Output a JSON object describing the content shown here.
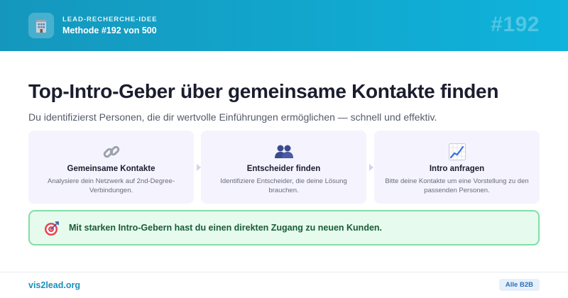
{
  "header": {
    "kicker": "LEAD-RECHERCHE-IDEE",
    "method": "Methode #192 von 500",
    "number": "#192",
    "logo_icon": "building-icon"
  },
  "main": {
    "title": "Top-Intro-Geber über gemeinsame Kontakte finden",
    "subtitle": "Du identifizierst Personen, die dir wertvolle Einführungen ermöglichen — schnell und effektiv."
  },
  "steps": [
    {
      "icon": "link-icon",
      "title": "Gemeinsame Kontakte",
      "description": "Analysiere dein Netzwerk auf 2nd-Degree-Verbindungen."
    },
    {
      "icon": "people-icon",
      "title": "Entscheider finden",
      "description": "Identifiziere Entscheider, die deine Lösung brauchen."
    },
    {
      "icon": "chart-up-icon",
      "title": "Intro anfragen",
      "description": "Bitte deine Kontakte um eine Vorstellung zu den passenden Personen."
    }
  ],
  "callout": {
    "icon": "target-icon",
    "text": "Mit starken Intro-Gebern hast du einen direkten Zugang zu neuen Kunden."
  },
  "footer": {
    "brand": "vis2lead.org",
    "badge": "Alle B2B"
  },
  "colors": {
    "header_start": "#1597bd",
    "header_end": "#0fb3db",
    "card_bg": "#f5f3fd",
    "callout_bg": "#e6faee",
    "callout_border": "#7fe0a7",
    "callout_text": "#185c36",
    "brand_link": "#1a8fbb"
  }
}
